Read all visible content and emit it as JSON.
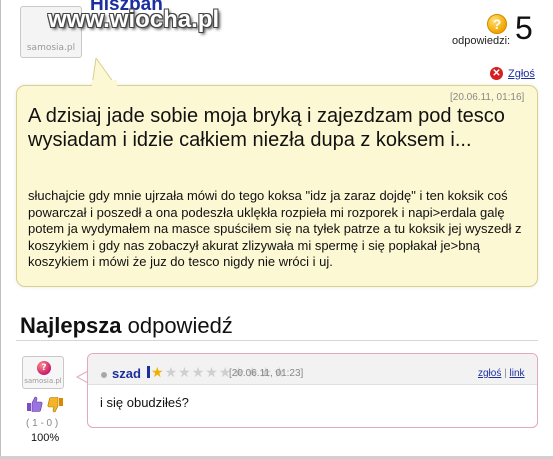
{
  "header": {
    "username": "Hiszpan",
    "watermark": "www.wiocha.pl",
    "avatar_caption": "samosia.pl",
    "answers_icon": "question-icon",
    "answers_label": "odpowiedzi:",
    "answers_count": "5",
    "report_icon": "close-icon",
    "report_label": "Zgłoś"
  },
  "question": {
    "date": "[20.06.11, 01:16]",
    "title": "A dzisiaj jade sobie moja bryką i zajezdzam pod tesco wysiadam i idzie całkiem niezła dupa z koksem i...",
    "body": "słuchajcie gdy mnie ujrzała mówi do tego koksa \"idz ja zaraz dojdę\" i ten koksik coś powarczał i poszedł a ona podeszła uklękła rozpieła mi rozporek i napi>erdala galę potem ja wydymałem na masce spuściłem się na tyłek patrze a tu koksik jej wyszedł z koszykiem i gdy nas zobaczył akurat zlizywała mi spermę i się popłakał je>bną koszykiem i mówi że juz do tesco nigdy nie wróci i uj."
  },
  "best_answer": {
    "heading_bold": "Najlepsza",
    "heading_rest": " odpowiedź",
    "avatar_caption": "samosia.pl",
    "thumb_up_icon": "thumbs-up-icon",
    "thumb_down_icon": "thumbs-down-icon",
    "votes": "( 1 - 0 )",
    "percent": "100%",
    "username": "szad",
    "rank_stars": 1,
    "rank_stars_total": 10,
    "date": "[20.06.11, 01:23]",
    "report_link": "zgłoś",
    "separator": "|",
    "link_label": "link",
    "text": "i się obudziłeś?"
  },
  "colors": {
    "link_blue": "#1c2fa0",
    "bubble_bg": "#fdf8d4",
    "bubble_border": "#d8d08c",
    "answer_border": "#e2a8bc",
    "report_red": "#d42020"
  }
}
